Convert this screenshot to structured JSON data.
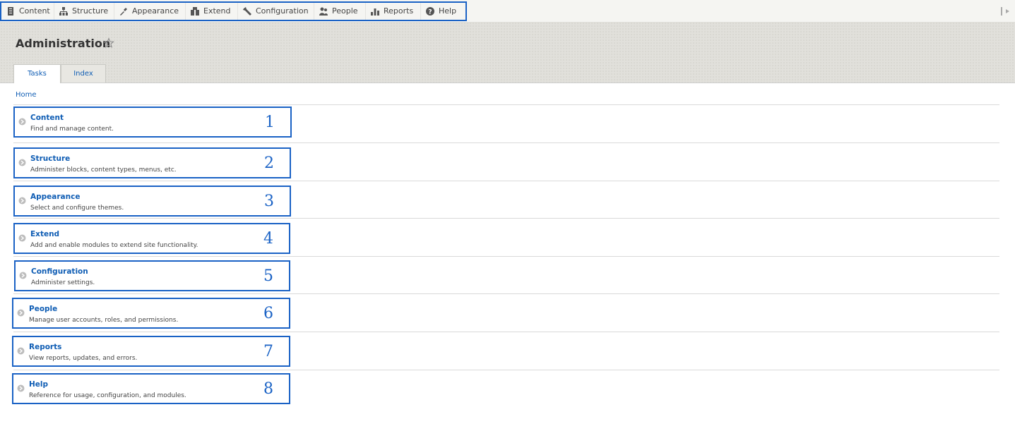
{
  "toolbar": {
    "items": [
      {
        "label": "Content",
        "icon": "content-icon"
      },
      {
        "label": "Structure",
        "icon": "structure-icon"
      },
      {
        "label": "Appearance",
        "icon": "appearance-icon"
      },
      {
        "label": "Extend",
        "icon": "extend-icon"
      },
      {
        "label": "Configuration",
        "icon": "wrench-icon"
      },
      {
        "label": "People",
        "icon": "people-icon"
      },
      {
        "label": "Reports",
        "icon": "reports-icon"
      },
      {
        "label": "Help",
        "icon": "help-icon"
      }
    ],
    "orientation_toggle_icon": "toolbar-orientation-icon",
    "highlight_color": "#1a62c5"
  },
  "header": {
    "title": "Administration",
    "shortcut_icon": "star-icon",
    "tabs": [
      {
        "label": "Tasks",
        "active": true
      },
      {
        "label": "Index",
        "active": false
      }
    ]
  },
  "breadcrumb": "Home",
  "tasks": [
    {
      "title": "Content",
      "description": "Find and manage content.",
      "number": "1"
    },
    {
      "title": "Structure",
      "description": "Administer blocks, content types, menus, etc.",
      "number": "2"
    },
    {
      "title": "Appearance",
      "description": "Select and configure themes.",
      "number": "3"
    },
    {
      "title": "Extend",
      "description": "Add and enable modules to extend site functionality.",
      "number": "4"
    },
    {
      "title": "Configuration",
      "description": "Administer settings.",
      "number": "5"
    },
    {
      "title": "People",
      "description": "Manage user accounts, roles, and permissions.",
      "number": "6"
    },
    {
      "title": "Reports",
      "description": "View reports, updates, and errors.",
      "number": "7"
    },
    {
      "title": "Help",
      "description": "Reference for usage, configuration, and modules.",
      "number": "8"
    }
  ],
  "colors": {
    "link": "#0f5db4",
    "annotation_border": "#1a62c5",
    "header_bg": "#e1e0db"
  }
}
